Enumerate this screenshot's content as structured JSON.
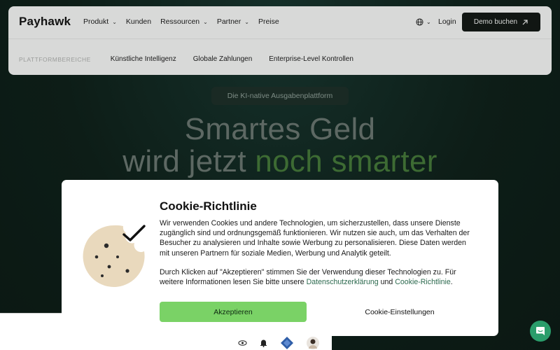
{
  "header": {
    "logo": "Payhawk",
    "nav": [
      {
        "label": "Produkt",
        "has_dropdown": true
      },
      {
        "label": "Kunden",
        "has_dropdown": false
      },
      {
        "label": "Ressourcen",
        "has_dropdown": true
      },
      {
        "label": "Partner",
        "has_dropdown": true
      },
      {
        "label": "Preise",
        "has_dropdown": false
      }
    ],
    "language_icon": "globe-icon",
    "login_label": "Login",
    "demo_label": "Demo buchen",
    "sub_label": "PLATTFORMBEREICHE",
    "sub_links": [
      "Künstliche Intelligenz",
      "Globale Zahlungen",
      "Enterprise-Level Kontrollen"
    ]
  },
  "hero": {
    "pill": "Die KI-native Ausgabenplattform",
    "line1": "Smartes Geld",
    "line2_prefix": "wird jetzt ",
    "line2_accent": "noch smarter"
  },
  "cookie_modal": {
    "title": "Cookie-Richtlinie",
    "paragraph1": "Wir verwenden Cookies und andere Technologien, um sicherzustellen, dass unsere Dienste zugänglich sind und ordnungsgemäß funktionieren. Wir nutzen sie auch, um das Verhalten der Besucher zu analysieren und Inhalte sowie Werbung zu personalisieren. Diese Daten werden mit unseren Partnern für soziale Medien, Werbung und Analytik geteilt.",
    "paragraph2_prefix": "Durch Klicken auf \"Akzeptieren\" stimmen Sie der Verwendung dieser Technologien zu. Für weitere Informationen lesen Sie bitte unsere ",
    "privacy_link": "Datenschutzerklärung",
    "paragraph2_mid": " und ",
    "cookie_link": "Cookie-Richtlinie",
    "paragraph2_suffix": ".",
    "accept_label": "Akzeptieren",
    "settings_label": "Cookie-Einstellungen"
  },
  "colors": {
    "accent_green": "#7ad266",
    "link_green": "#2d6a4f",
    "chat_bubble": "#2a9d6b",
    "header_bg": "#d8d9d8",
    "page_bg": "#0e1f18"
  }
}
